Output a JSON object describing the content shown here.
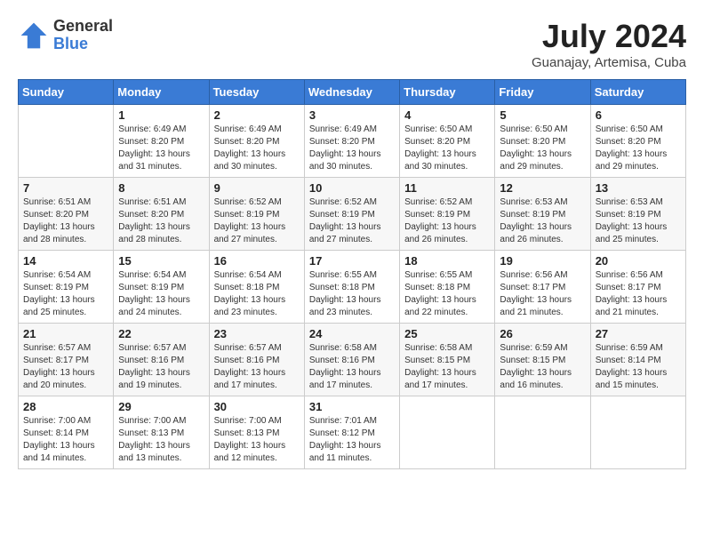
{
  "logo": {
    "general": "General",
    "blue": "Blue"
  },
  "title": {
    "month_year": "July 2024",
    "location": "Guanajay, Artemisa, Cuba"
  },
  "days_of_week": [
    "Sunday",
    "Monday",
    "Tuesday",
    "Wednesday",
    "Thursday",
    "Friday",
    "Saturday"
  ],
  "weeks": [
    [
      {
        "day": "",
        "sunrise": "",
        "sunset": "",
        "daylight": ""
      },
      {
        "day": "1",
        "sunrise": "Sunrise: 6:49 AM",
        "sunset": "Sunset: 8:20 PM",
        "daylight": "Daylight: 13 hours and 31 minutes."
      },
      {
        "day": "2",
        "sunrise": "Sunrise: 6:49 AM",
        "sunset": "Sunset: 8:20 PM",
        "daylight": "Daylight: 13 hours and 30 minutes."
      },
      {
        "day": "3",
        "sunrise": "Sunrise: 6:49 AM",
        "sunset": "Sunset: 8:20 PM",
        "daylight": "Daylight: 13 hours and 30 minutes."
      },
      {
        "day": "4",
        "sunrise": "Sunrise: 6:50 AM",
        "sunset": "Sunset: 8:20 PM",
        "daylight": "Daylight: 13 hours and 30 minutes."
      },
      {
        "day": "5",
        "sunrise": "Sunrise: 6:50 AM",
        "sunset": "Sunset: 8:20 PM",
        "daylight": "Daylight: 13 hours and 29 minutes."
      },
      {
        "day": "6",
        "sunrise": "Sunrise: 6:50 AM",
        "sunset": "Sunset: 8:20 PM",
        "daylight": "Daylight: 13 hours and 29 minutes."
      }
    ],
    [
      {
        "day": "7",
        "sunrise": "Sunrise: 6:51 AM",
        "sunset": "Sunset: 8:20 PM",
        "daylight": "Daylight: 13 hours and 28 minutes."
      },
      {
        "day": "8",
        "sunrise": "Sunrise: 6:51 AM",
        "sunset": "Sunset: 8:20 PM",
        "daylight": "Daylight: 13 hours and 28 minutes."
      },
      {
        "day": "9",
        "sunrise": "Sunrise: 6:52 AM",
        "sunset": "Sunset: 8:19 PM",
        "daylight": "Daylight: 13 hours and 27 minutes."
      },
      {
        "day": "10",
        "sunrise": "Sunrise: 6:52 AM",
        "sunset": "Sunset: 8:19 PM",
        "daylight": "Daylight: 13 hours and 27 minutes."
      },
      {
        "day": "11",
        "sunrise": "Sunrise: 6:52 AM",
        "sunset": "Sunset: 8:19 PM",
        "daylight": "Daylight: 13 hours and 26 minutes."
      },
      {
        "day": "12",
        "sunrise": "Sunrise: 6:53 AM",
        "sunset": "Sunset: 8:19 PM",
        "daylight": "Daylight: 13 hours and 26 minutes."
      },
      {
        "day": "13",
        "sunrise": "Sunrise: 6:53 AM",
        "sunset": "Sunset: 8:19 PM",
        "daylight": "Daylight: 13 hours and 25 minutes."
      }
    ],
    [
      {
        "day": "14",
        "sunrise": "Sunrise: 6:54 AM",
        "sunset": "Sunset: 8:19 PM",
        "daylight": "Daylight: 13 hours and 25 minutes."
      },
      {
        "day": "15",
        "sunrise": "Sunrise: 6:54 AM",
        "sunset": "Sunset: 8:19 PM",
        "daylight": "Daylight: 13 hours and 24 minutes."
      },
      {
        "day": "16",
        "sunrise": "Sunrise: 6:54 AM",
        "sunset": "Sunset: 8:18 PM",
        "daylight": "Daylight: 13 hours and 23 minutes."
      },
      {
        "day": "17",
        "sunrise": "Sunrise: 6:55 AM",
        "sunset": "Sunset: 8:18 PM",
        "daylight": "Daylight: 13 hours and 23 minutes."
      },
      {
        "day": "18",
        "sunrise": "Sunrise: 6:55 AM",
        "sunset": "Sunset: 8:18 PM",
        "daylight": "Daylight: 13 hours and 22 minutes."
      },
      {
        "day": "19",
        "sunrise": "Sunrise: 6:56 AM",
        "sunset": "Sunset: 8:17 PM",
        "daylight": "Daylight: 13 hours and 21 minutes."
      },
      {
        "day": "20",
        "sunrise": "Sunrise: 6:56 AM",
        "sunset": "Sunset: 8:17 PM",
        "daylight": "Daylight: 13 hours and 21 minutes."
      }
    ],
    [
      {
        "day": "21",
        "sunrise": "Sunrise: 6:57 AM",
        "sunset": "Sunset: 8:17 PM",
        "daylight": "Daylight: 13 hours and 20 minutes."
      },
      {
        "day": "22",
        "sunrise": "Sunrise: 6:57 AM",
        "sunset": "Sunset: 8:16 PM",
        "daylight": "Daylight: 13 hours and 19 minutes."
      },
      {
        "day": "23",
        "sunrise": "Sunrise: 6:57 AM",
        "sunset": "Sunset: 8:16 PM",
        "daylight": "Daylight: 13 hours and 17 minutes."
      },
      {
        "day": "24",
        "sunrise": "Sunrise: 6:58 AM",
        "sunset": "Sunset: 8:16 PM",
        "daylight": "Daylight: 13 hours and 17 minutes."
      },
      {
        "day": "25",
        "sunrise": "Sunrise: 6:58 AM",
        "sunset": "Sunset: 8:15 PM",
        "daylight": "Daylight: 13 hours and 17 minutes."
      },
      {
        "day": "26",
        "sunrise": "Sunrise: 6:59 AM",
        "sunset": "Sunset: 8:15 PM",
        "daylight": "Daylight: 13 hours and 16 minutes."
      },
      {
        "day": "27",
        "sunrise": "Sunrise: 6:59 AM",
        "sunset": "Sunset: 8:14 PM",
        "daylight": "Daylight: 13 hours and 15 minutes."
      }
    ],
    [
      {
        "day": "28",
        "sunrise": "Sunrise: 7:00 AM",
        "sunset": "Sunset: 8:14 PM",
        "daylight": "Daylight: 13 hours and 14 minutes."
      },
      {
        "day": "29",
        "sunrise": "Sunrise: 7:00 AM",
        "sunset": "Sunset: 8:13 PM",
        "daylight": "Daylight: 13 hours and 13 minutes."
      },
      {
        "day": "30",
        "sunrise": "Sunrise: 7:00 AM",
        "sunset": "Sunset: 8:13 PM",
        "daylight": "Daylight: 13 hours and 12 minutes."
      },
      {
        "day": "31",
        "sunrise": "Sunrise: 7:01 AM",
        "sunset": "Sunset: 8:12 PM",
        "daylight": "Daylight: 13 hours and 11 minutes."
      },
      {
        "day": "",
        "sunrise": "",
        "sunset": "",
        "daylight": ""
      },
      {
        "day": "",
        "sunrise": "",
        "sunset": "",
        "daylight": ""
      },
      {
        "day": "",
        "sunrise": "",
        "sunset": "",
        "daylight": ""
      }
    ]
  ]
}
